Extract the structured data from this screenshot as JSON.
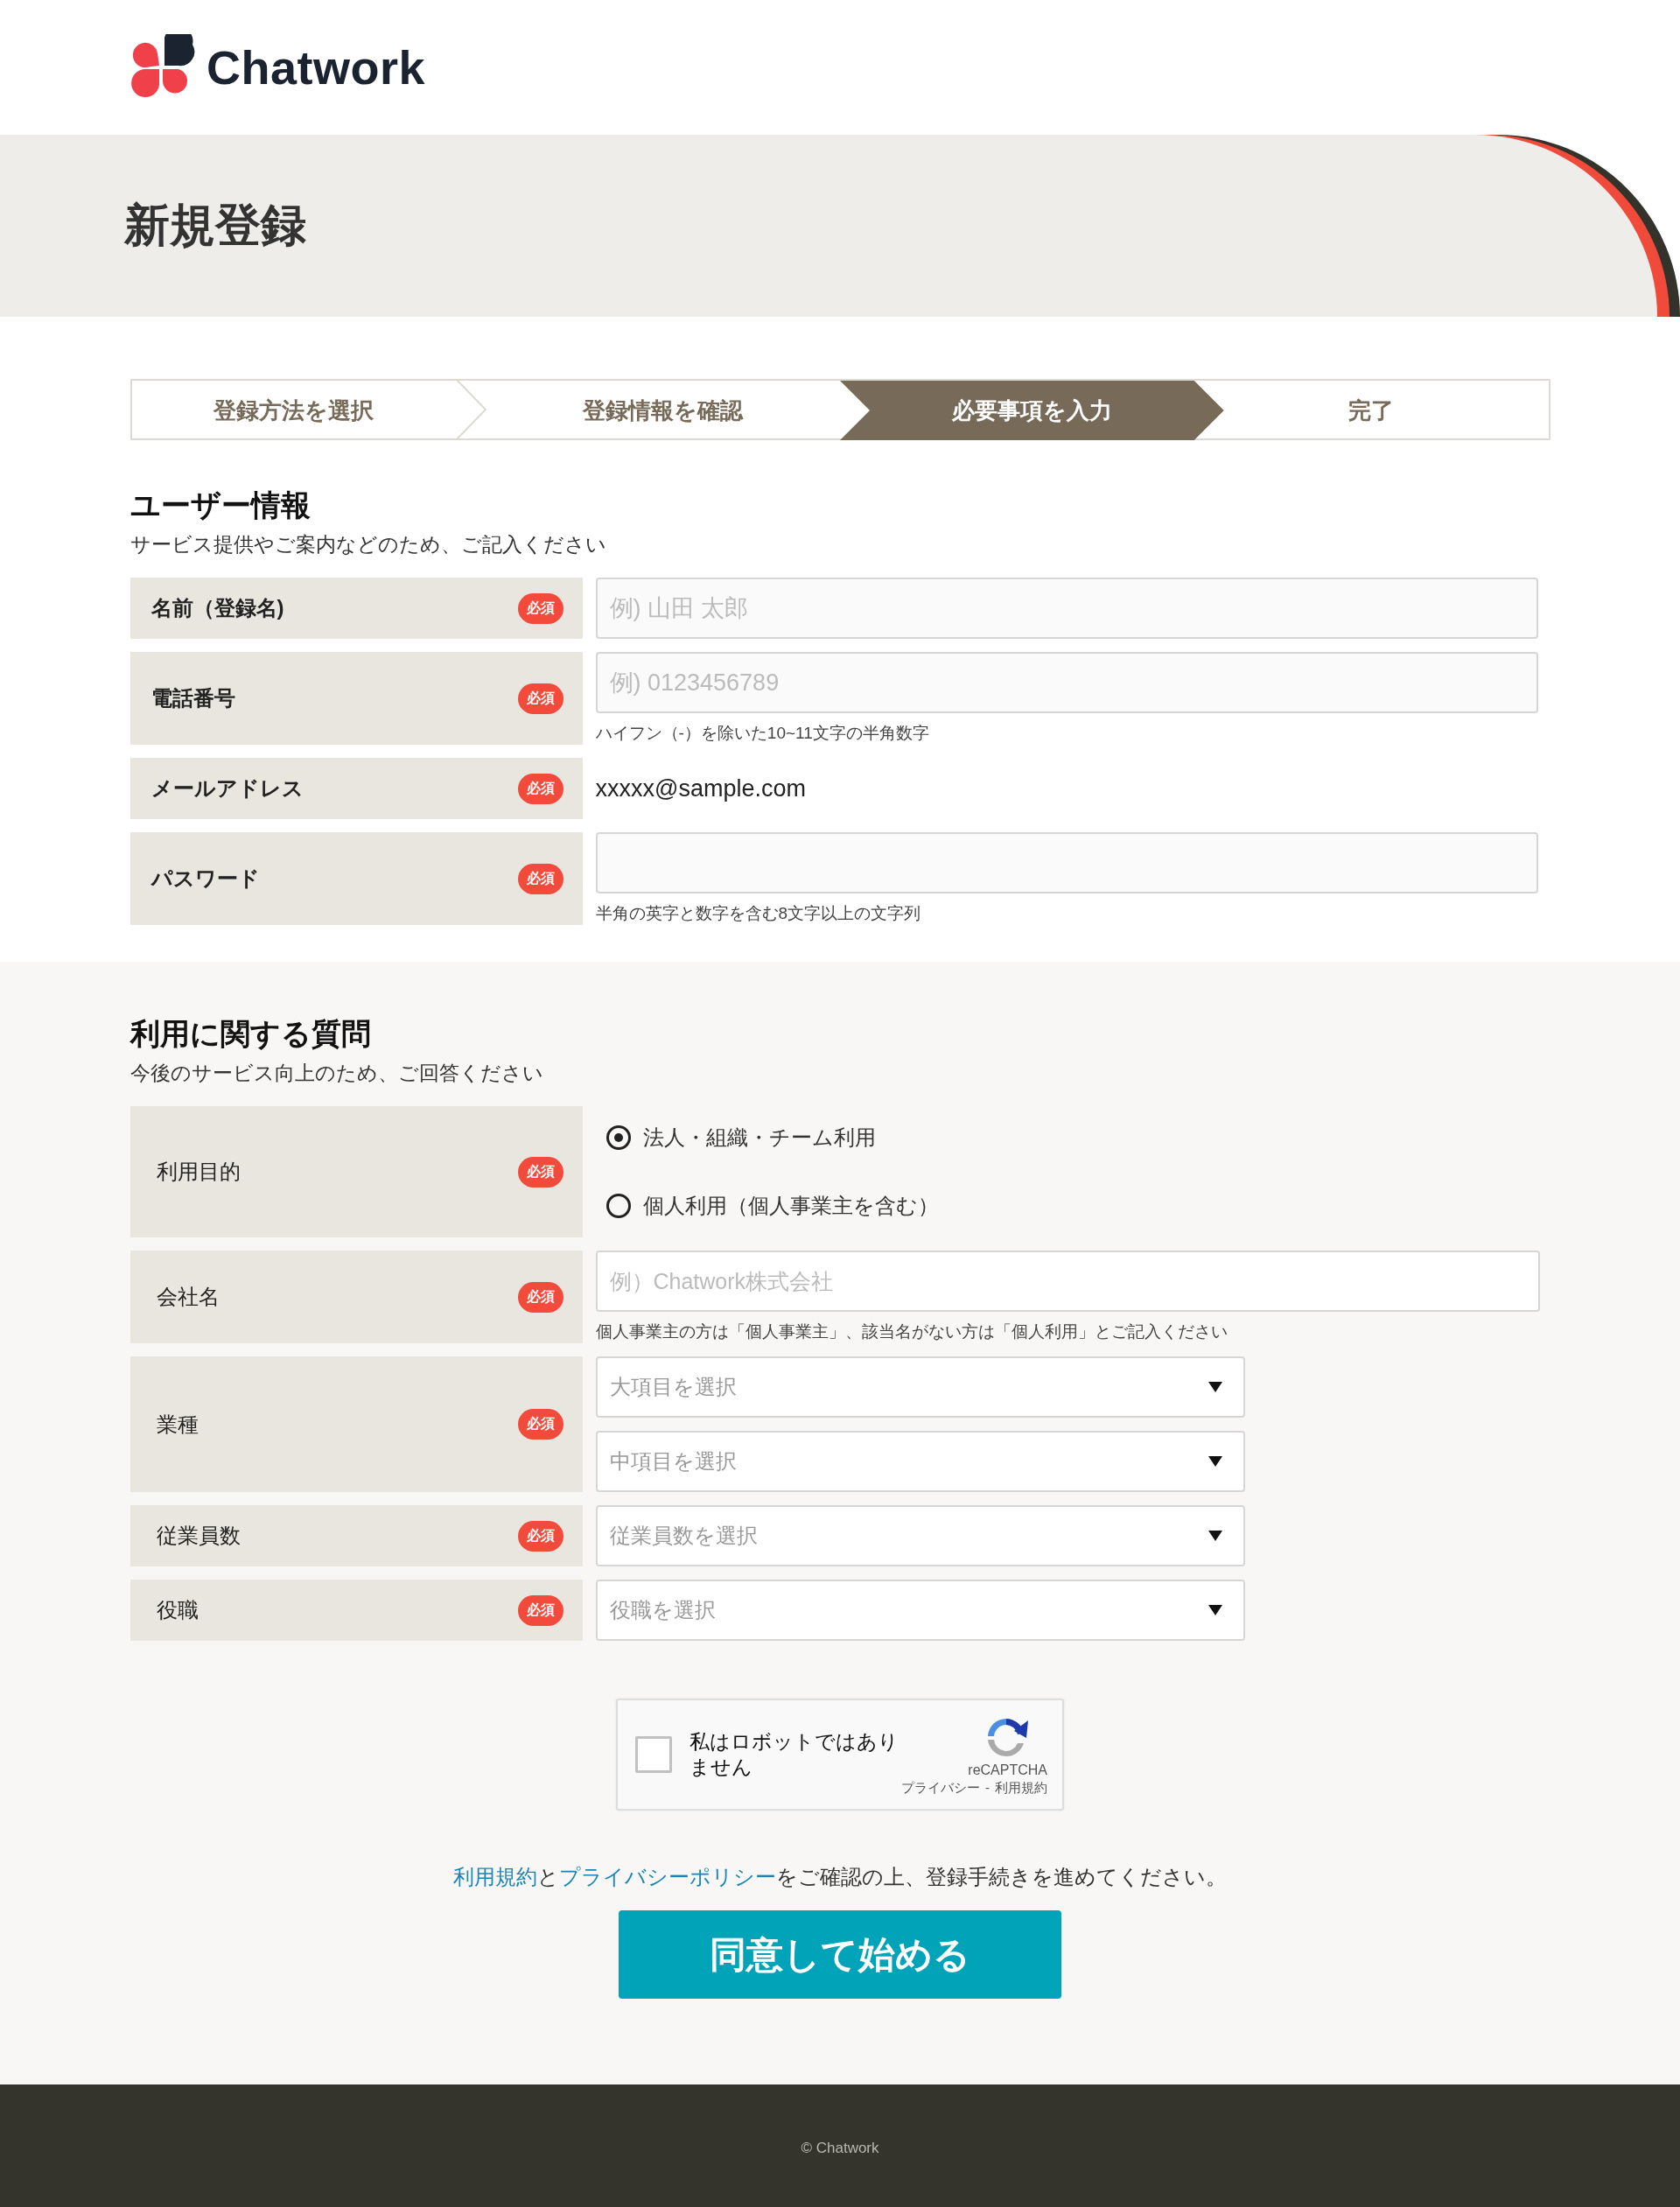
{
  "header": {
    "logo_text": "Chatwork"
  },
  "page_title": "新規登録",
  "steps": [
    {
      "label": "登録方法を選択",
      "selected": false
    },
    {
      "label": "登録情報を確認",
      "selected": false
    },
    {
      "label": "必要事項を入力",
      "selected": true
    },
    {
      "label": "完了",
      "selected": false
    }
  ],
  "sections": [
    {
      "title": "ユーザー情報",
      "subtitle": "サービス提供やご案内などのため、ご記入ください",
      "fields": [
        {
          "kind": "text",
          "label": "名前（登録名)",
          "badge": "必須",
          "placeholder": "例) 山田 太郎"
        },
        {
          "kind": "text",
          "label": "電話番号",
          "badge": "必須",
          "placeholder": "例) 0123456789",
          "hint": "ハイフン（-）を除いた10~11文字の半角数字"
        },
        {
          "kind": "static",
          "label": "メールアドレス",
          "badge": "必須",
          "value": "xxxxx@sample.com"
        },
        {
          "kind": "password",
          "label": "パスワード",
          "badge": "必須",
          "hint": "半角の英字と数字を含む8文字以上の文字列"
        }
      ]
    },
    {
      "title": "利用に関する質問",
      "subtitle": "今後のサービス向上のため、ご回答ください",
      "fields": [
        {
          "kind": "radio",
          "label": "利用目的",
          "badge": "必須",
          "options": [
            {
              "label": "法人・組織・チーム利用",
              "selected": true
            },
            {
              "label": "個人利用（個人事業主を含む）",
              "selected": false
            }
          ]
        },
        {
          "kind": "text",
          "label": "会社名",
          "badge": "必須",
          "placeholder": "例）Chatwork株式会社",
          "hint": "個人事業主の方は「個人事業主」、該当名がない方は「個人利用」とご記入ください"
        },
        {
          "kind": "select",
          "label": "業種",
          "badge": "必須",
          "selects": [
            {
              "placeholder": "大項目を選択"
            },
            {
              "placeholder": "中項目を選択"
            }
          ]
        },
        {
          "kind": "select",
          "label": "従業員数",
          "badge": "必須",
          "selects": [
            {
              "placeholder": "従業員数を選択"
            }
          ]
        },
        {
          "kind": "select",
          "label": "役職",
          "badge": "必須",
          "selects": [
            {
              "placeholder": "役職を選択"
            }
          ]
        }
      ]
    }
  ],
  "recaptcha": {
    "label": "私はロボットではありません",
    "checked": false,
    "brand": "reCAPTCHA",
    "privacy": "プライバシー",
    "separator": "-",
    "terms": "利用規約"
  },
  "consent": [
    {
      "text": "利用規約",
      "link": true
    },
    {
      "text": "と",
      "link": false
    },
    {
      "text": "プライバシーポリシー",
      "link": true
    },
    {
      "text": "をご確認の上、登録手続きを進めてください。",
      "link": false
    }
  ],
  "submit_button": "同意して始める",
  "footer": "© Chatwork"
}
